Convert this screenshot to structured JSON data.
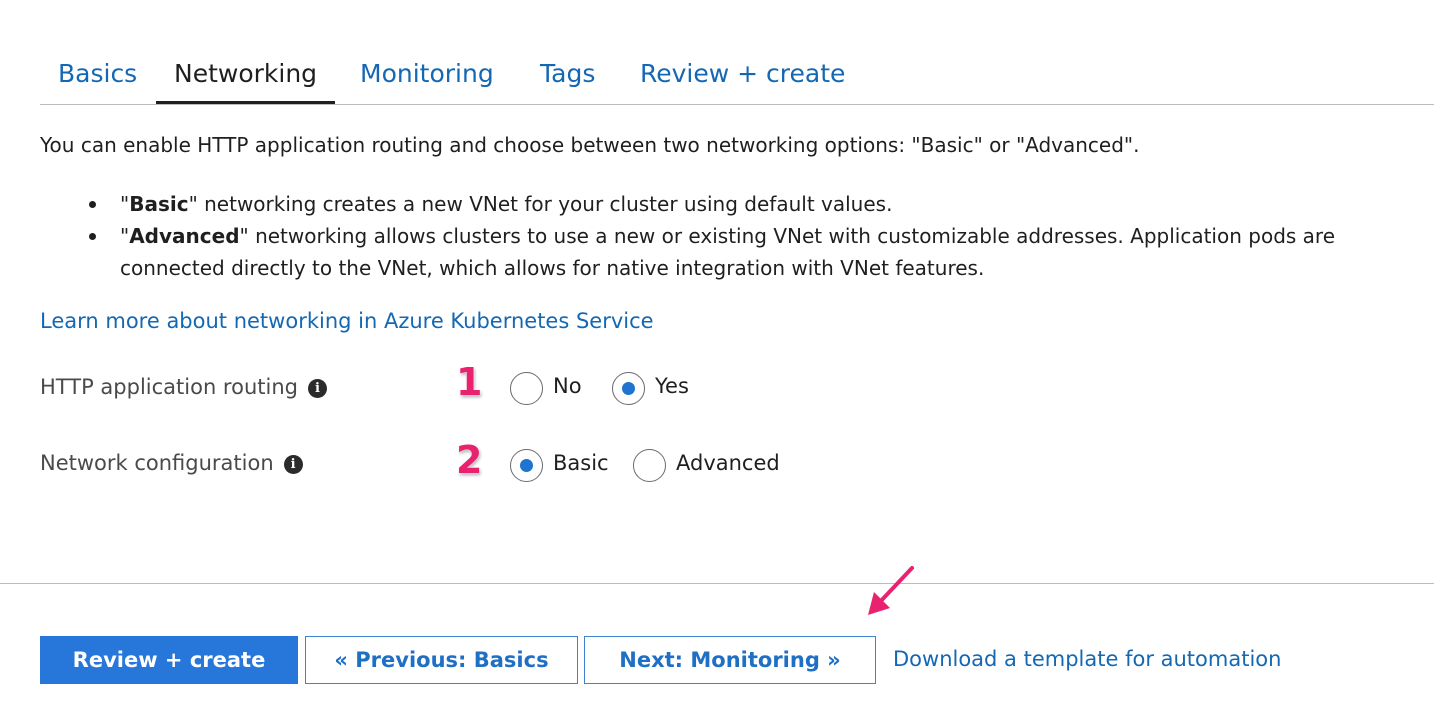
{
  "tabs": [
    {
      "label": "Basics",
      "active": false
    },
    {
      "label": "Networking",
      "active": true
    },
    {
      "label": "Monitoring",
      "active": false
    },
    {
      "label": "Tags",
      "active": false
    },
    {
      "label": "Review + create",
      "active": false
    }
  ],
  "intro": "You can enable HTTP application routing and choose between two networking options: \"Basic\" or \"Advanced\".",
  "bullets": [
    {
      "open_quote": "\"",
      "bold": "Basic",
      "rest": "\" networking creates a new VNet for your cluster using default values."
    },
    {
      "open_quote": "\"",
      "bold": "Advanced",
      "rest": "\" networking allows clusters to use a new or existing VNet with customizable addresses. Application pods are connected directly to the VNet, which allows for native integration with VNet features."
    }
  ],
  "learn_more_link": "Learn more about networking in Azure Kubernetes Service",
  "fields": {
    "http_routing": {
      "label": "HTTP application routing",
      "step": "1",
      "options": [
        {
          "label": "No",
          "checked": false
        },
        {
          "label": "Yes",
          "checked": true
        }
      ]
    },
    "network_config": {
      "label": "Network configuration",
      "step": "2",
      "options": [
        {
          "label": "Basic",
          "checked": true
        },
        {
          "label": "Advanced",
          "checked": false
        }
      ]
    }
  },
  "footer": {
    "review_create": "Review + create",
    "previous": "« Previous: Basics",
    "next": "Next: Monitoring »",
    "download_link": "Download a template for automation"
  },
  "colors": {
    "link": "#1468b3",
    "primary": "#2677d9",
    "annotation": "#e8226e",
    "radio_selected": "#1f73d1"
  },
  "icons": {
    "info": "info-icon",
    "annotation_arrow": "arrow-icon"
  }
}
